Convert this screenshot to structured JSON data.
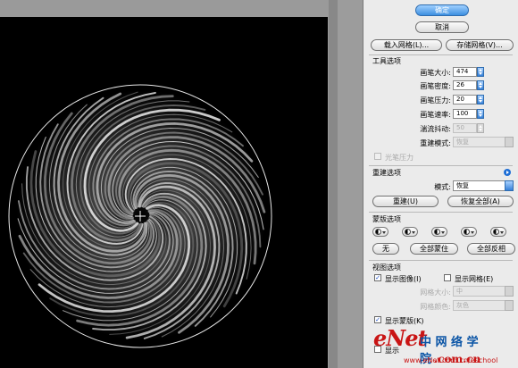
{
  "buttons": {
    "ok": "确定",
    "cancel": "取消",
    "load_mesh": "载入网格(L)...",
    "save_mesh": "存储网格(V)...",
    "reconstruct": "重建(U)",
    "restore_all": "恢复全部(A)",
    "mask_none": "无",
    "mask_all": "全部蒙住",
    "invert_all": "全部反相"
  },
  "tool_options": {
    "title": "工具选项",
    "brush_size": {
      "label": "画笔大小:",
      "value": "474"
    },
    "brush_density": {
      "label": "画笔密度:",
      "value": "26"
    },
    "brush_pressure": {
      "label": "画笔压力:",
      "value": "20"
    },
    "brush_rate": {
      "label": "画笔速率:",
      "value": "100"
    },
    "turbulent_jitter": {
      "label": "湍流抖动:",
      "value": "50"
    },
    "reconstruct_mode": {
      "label": "重建模式:",
      "value": "恢复"
    },
    "stylus_pressure": "光笔压力"
  },
  "reconstruct_options": {
    "title": "重建选项",
    "mode": {
      "label": "模式:",
      "value": "恢复"
    }
  },
  "mask_options": {
    "title": "蒙版选项"
  },
  "view_options": {
    "title": "视图选项",
    "show_image": "显示图像(I)",
    "show_mesh": "显示网格(E)",
    "mesh_size": {
      "label": "网格大小:",
      "value": "中"
    },
    "mesh_color": {
      "label": "网格颜色:",
      "value": "灰色"
    },
    "show_mask": "显示蒙版(K)",
    "show_backdrop": "显示"
  },
  "watermark": {
    "logo": "eNet",
    "text": "中 网 络 学 院",
    "domain": ".com.cn",
    "url": "www.eNet.com.cn/eschool"
  },
  "colors": {
    "accent": "#3d8fe0",
    "watermark_red": "#c91515",
    "watermark_blue": "#0b55a6"
  }
}
